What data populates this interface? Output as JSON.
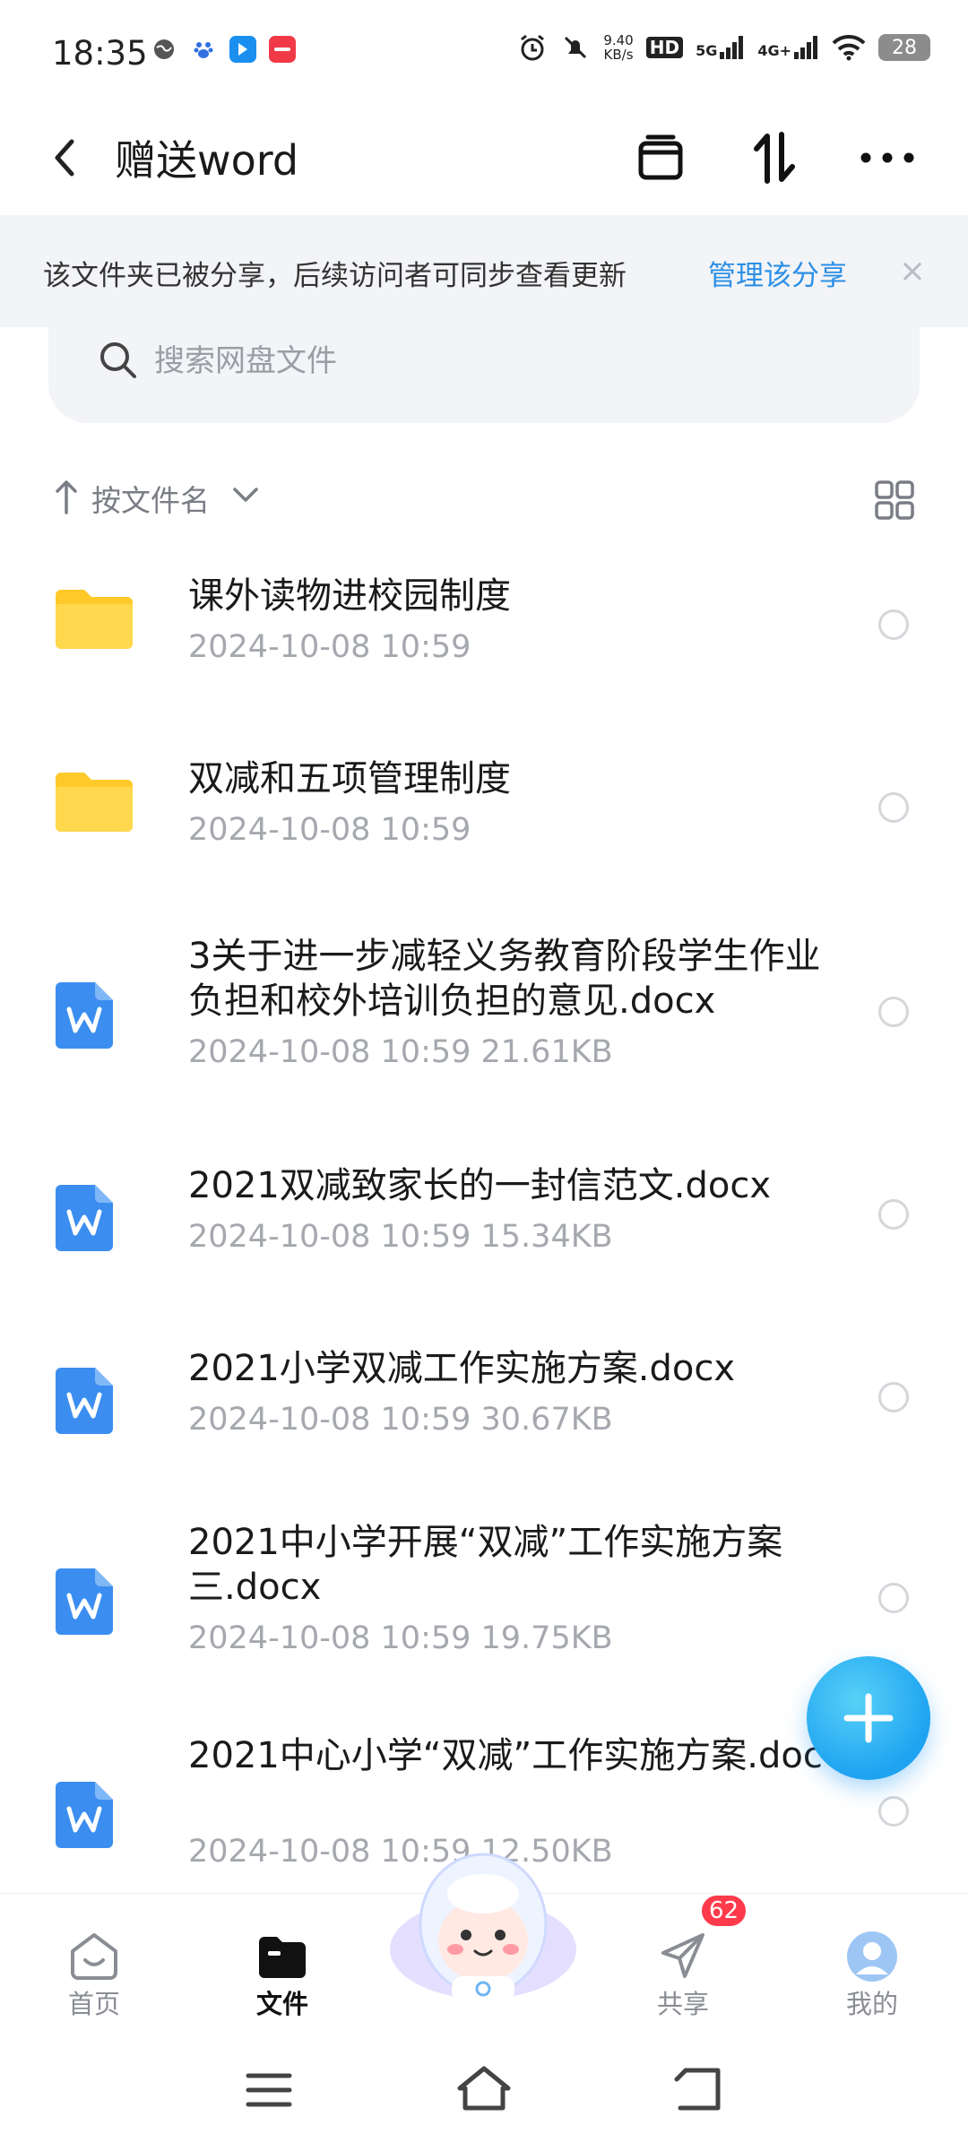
{
  "status_bar": {
    "time": "18:35",
    "net_speed_value": "9.40",
    "net_speed_unit": "KB/s",
    "hd": "HD",
    "signal1": "5G",
    "signal2": "4G+",
    "battery": "28"
  },
  "header": {
    "title": "赠送word",
    "back_icon": "back-arrow-icon",
    "actions": [
      "archive-icon",
      "sort-toggle-icon",
      "more-icon"
    ]
  },
  "share_banner": {
    "text": "该文件夹已被分享，后续访问者可同步查看更新",
    "link": "管理该分享",
    "close": "×"
  },
  "search": {
    "placeholder": "搜索网盘文件"
  },
  "sort": {
    "label": "按文件名"
  },
  "files": [
    {
      "type": "folder",
      "name": "课外读物进校园制度",
      "meta": "2024-10-08  10:59"
    },
    {
      "type": "folder",
      "name": "双减和五项管理制度",
      "meta": "2024-10-08  10:59"
    },
    {
      "type": "word",
      "name": "3关于进一步减轻义务教育阶段学生作业负担和校外培训负担的意见.docx",
      "meta": "2024-10-08  10:59  21.61KB"
    },
    {
      "type": "word",
      "name": "2021双减致家长的一封信范文.docx",
      "meta": "2024-10-08  10:59  15.34KB"
    },
    {
      "type": "word",
      "name": "2021小学双减工作实施方案.docx",
      "meta": "2024-10-08  10:59  30.67KB"
    },
    {
      "type": "word",
      "name": "2021中小学开展“双减”工作实施方案三.docx",
      "meta": "2024-10-08  10:59  19.75KB"
    },
    {
      "type": "word",
      "name": "2021中心小学“双减”工作实施方案.doc",
      "meta": "2024-10-08  10:59  12.50KB"
    }
  ],
  "fab_label": "+",
  "bottom_nav": [
    {
      "label": "首页",
      "icon": "home-icon"
    },
    {
      "label": "文件",
      "icon": "folder-icon",
      "active": true
    },
    {
      "label": "共享",
      "icon": "send-icon",
      "badge": "62"
    },
    {
      "label": "我的",
      "icon": "profile-icon"
    }
  ],
  "colors": {
    "accent": "#2b8fe6",
    "folder": "#ffcf33",
    "word": "#3b8ef0",
    "badge": "#ff3b4b"
  }
}
